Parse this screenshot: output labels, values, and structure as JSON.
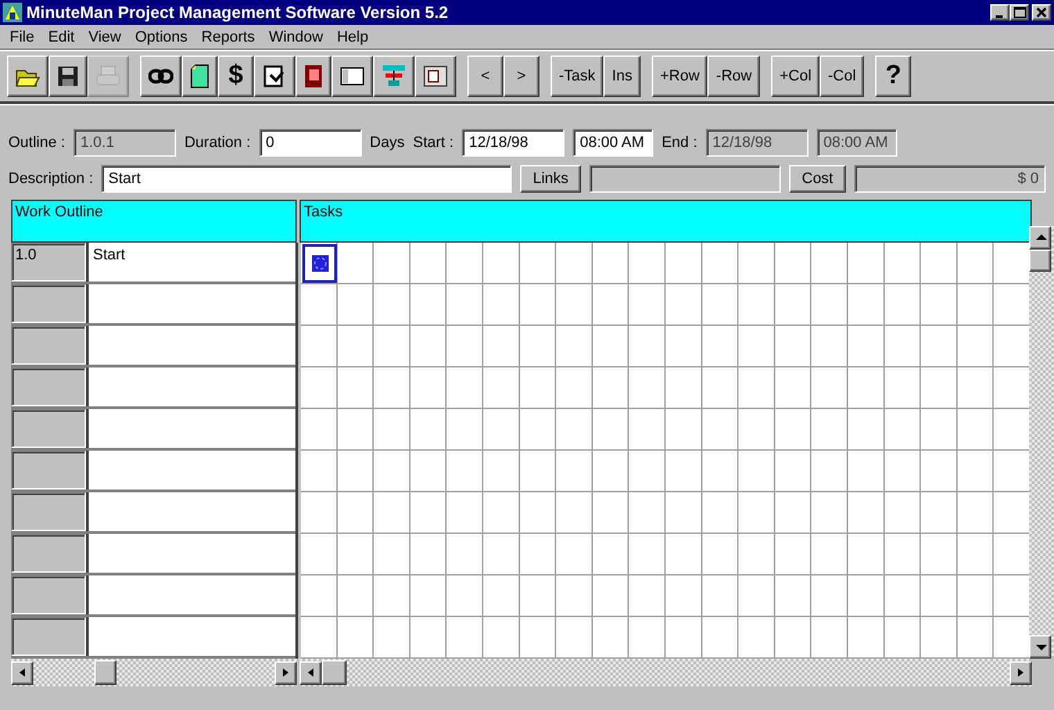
{
  "window": {
    "title": "MinuteMan Project Management Software Version 5.2"
  },
  "menu": [
    "File",
    "Edit",
    "View",
    "Options",
    "Reports",
    "Window",
    "Help"
  ],
  "toolbar": [
    [
      {
        "kind": "open"
      },
      {
        "kind": "save"
      },
      {
        "kind": "print",
        "disabled": true
      }
    ],
    [
      {
        "kind": "link"
      },
      {
        "kind": "note"
      },
      {
        "kind": "text",
        "label": "$"
      },
      {
        "kind": "task"
      },
      {
        "kind": "book"
      },
      {
        "kind": "window"
      },
      {
        "kind": "chart"
      },
      {
        "kind": "dialog"
      }
    ],
    [
      {
        "kind": "text",
        "label": "<"
      },
      {
        "kind": "text",
        "label": ">"
      }
    ],
    [
      {
        "kind": "text",
        "label": "-Task"
      },
      {
        "kind": "text",
        "label": "Ins"
      }
    ],
    [
      {
        "kind": "text",
        "label": "+Row"
      },
      {
        "kind": "text",
        "label": "-Row"
      }
    ],
    [
      {
        "kind": "text",
        "label": "+Col"
      },
      {
        "kind": "text",
        "label": "-Col"
      }
    ],
    [
      {
        "kind": "text",
        "label": "?"
      }
    ]
  ],
  "fields_row": [
    {
      "kind": "label",
      "text": "Outline :"
    },
    {
      "kind": "field",
      "value": "1.0.1",
      "readonly": true
    },
    {
      "kind": "label",
      "text": "Duration :"
    },
    {
      "kind": "field",
      "value": "0",
      "readonly": false
    },
    {
      "kind": "label",
      "text": "Days"
    },
    {
      "kind": "label",
      "text": "Start :"
    },
    {
      "kind": "field",
      "value": "12/18/98",
      "readonly": false
    },
    {
      "kind": "field",
      "value": "08:00 AM",
      "readonly": false
    },
    {
      "kind": "label",
      "text": "End :"
    },
    {
      "kind": "field",
      "value": "12/18/98",
      "readonly": true
    },
    {
      "kind": "field",
      "value": "08:00 AM",
      "readonly": true
    }
  ],
  "description_row": [
    {
      "kind": "label",
      "text": "Description :"
    },
    {
      "kind": "field",
      "value": "Start",
      "readonly": false
    },
    {
      "kind": "button",
      "text": "Links"
    },
    {
      "kind": "field",
      "readonly": true
    },
    {
      "kind": "button",
      "text": "Cost"
    },
    {
      "kind": "field",
      "value": "$ 0",
      "readonly": true
    }
  ],
  "outline_header": "Work Outline",
  "tasks_header": "Tasks",
  "rows": [
    {
      "outline": "1.0",
      "description": "Start",
      "milestone": true
    },
    {
      "milestone": false
    },
    {
      "milestone": false
    },
    {
      "milestone": false
    },
    {
      "milestone": false
    },
    {
      "milestone": false
    },
    {
      "milestone": false
    },
    {
      "milestone": false
    },
    {
      "milestone": false
    },
    {
      "milestone": false
    }
  ]
}
